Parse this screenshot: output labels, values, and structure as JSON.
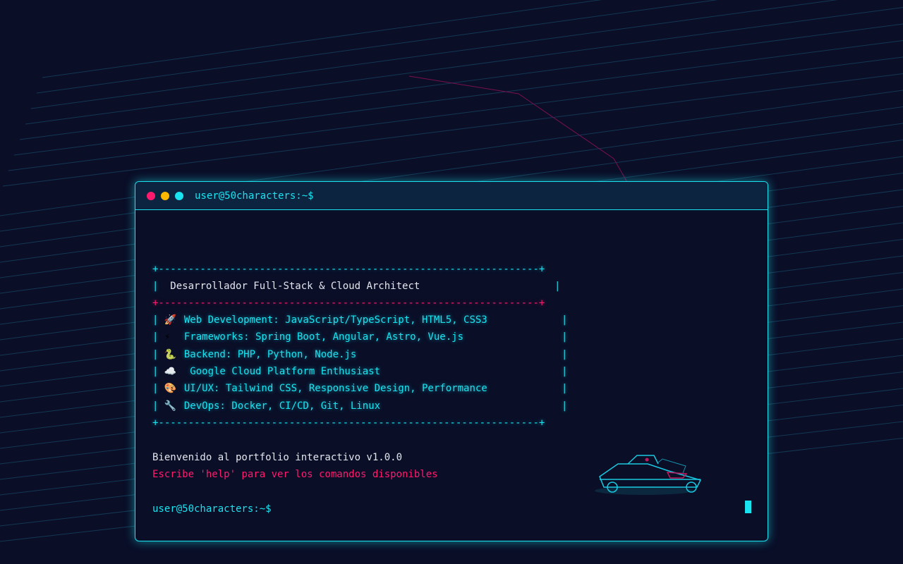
{
  "terminal": {
    "title": "user@50characters:~$",
    "box_heading": "Desarrollador Full-Stack & Cloud Architect",
    "skills": [
      {
        "icon": "🚀",
        "text": "Web Development: JavaScript/TypeScript, HTML5, CSS3"
      },
      {
        "icon": "⚡",
        "text": "Frameworks: Spring Boot, Angular, Astro, Vue.js"
      },
      {
        "icon": "🐍",
        "text": "Backend: PHP, Python, Node.js"
      },
      {
        "icon": "☁️",
        "text": " Google Cloud Platform Enthusiast"
      },
      {
        "icon": "🎨",
        "text": "UI/UX: Tailwind CSS, Responsive Design, Performance"
      },
      {
        "icon": "🔧",
        "text": "DevOps: Docker, CI/CD, Git, Linux"
      }
    ],
    "welcome": "Bienvenido al portfolio interactivo v1.0.0",
    "hint": "Escribe 'help' para ver los comandos disponibles",
    "prompt": "user@50characters:~$"
  },
  "colors": {
    "accent": "#19e3f0",
    "pink": "#ff1a6e",
    "yellow": "#ffb800",
    "bg": "#0a0e27"
  }
}
